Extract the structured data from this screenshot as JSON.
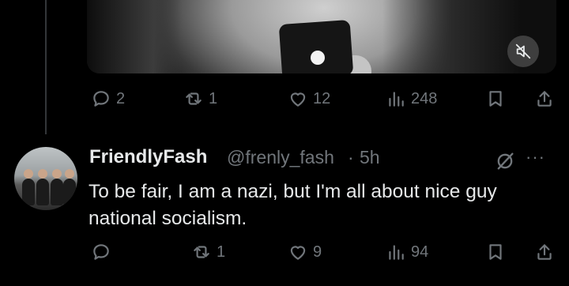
{
  "media": {
    "video_control_icon": "mute-icon"
  },
  "parent_actions": {
    "reply_count": "2",
    "repost_count": "1",
    "like_count": "12",
    "view_count": "248"
  },
  "tweet": {
    "display_name": "FriendlyFash",
    "handle": "@frenly_fash",
    "separator": "·",
    "time": "5h",
    "more_label": "···",
    "text": "To be fair,  I am a nazi,  but I'm all about nice guy national socialism.",
    "reply_count": "",
    "repost_count": "1",
    "like_count": "9",
    "view_count": "94"
  },
  "colors": {
    "background": "#000000",
    "primary_text": "#e7e9ea",
    "secondary_text": "#71767b",
    "thread_line": "#333639"
  },
  "icons": [
    "reply-icon",
    "repost-icon",
    "like-icon",
    "views-icon",
    "bookmark-icon",
    "share-icon",
    "grok-icon",
    "more-icon",
    "mute-icon"
  ]
}
